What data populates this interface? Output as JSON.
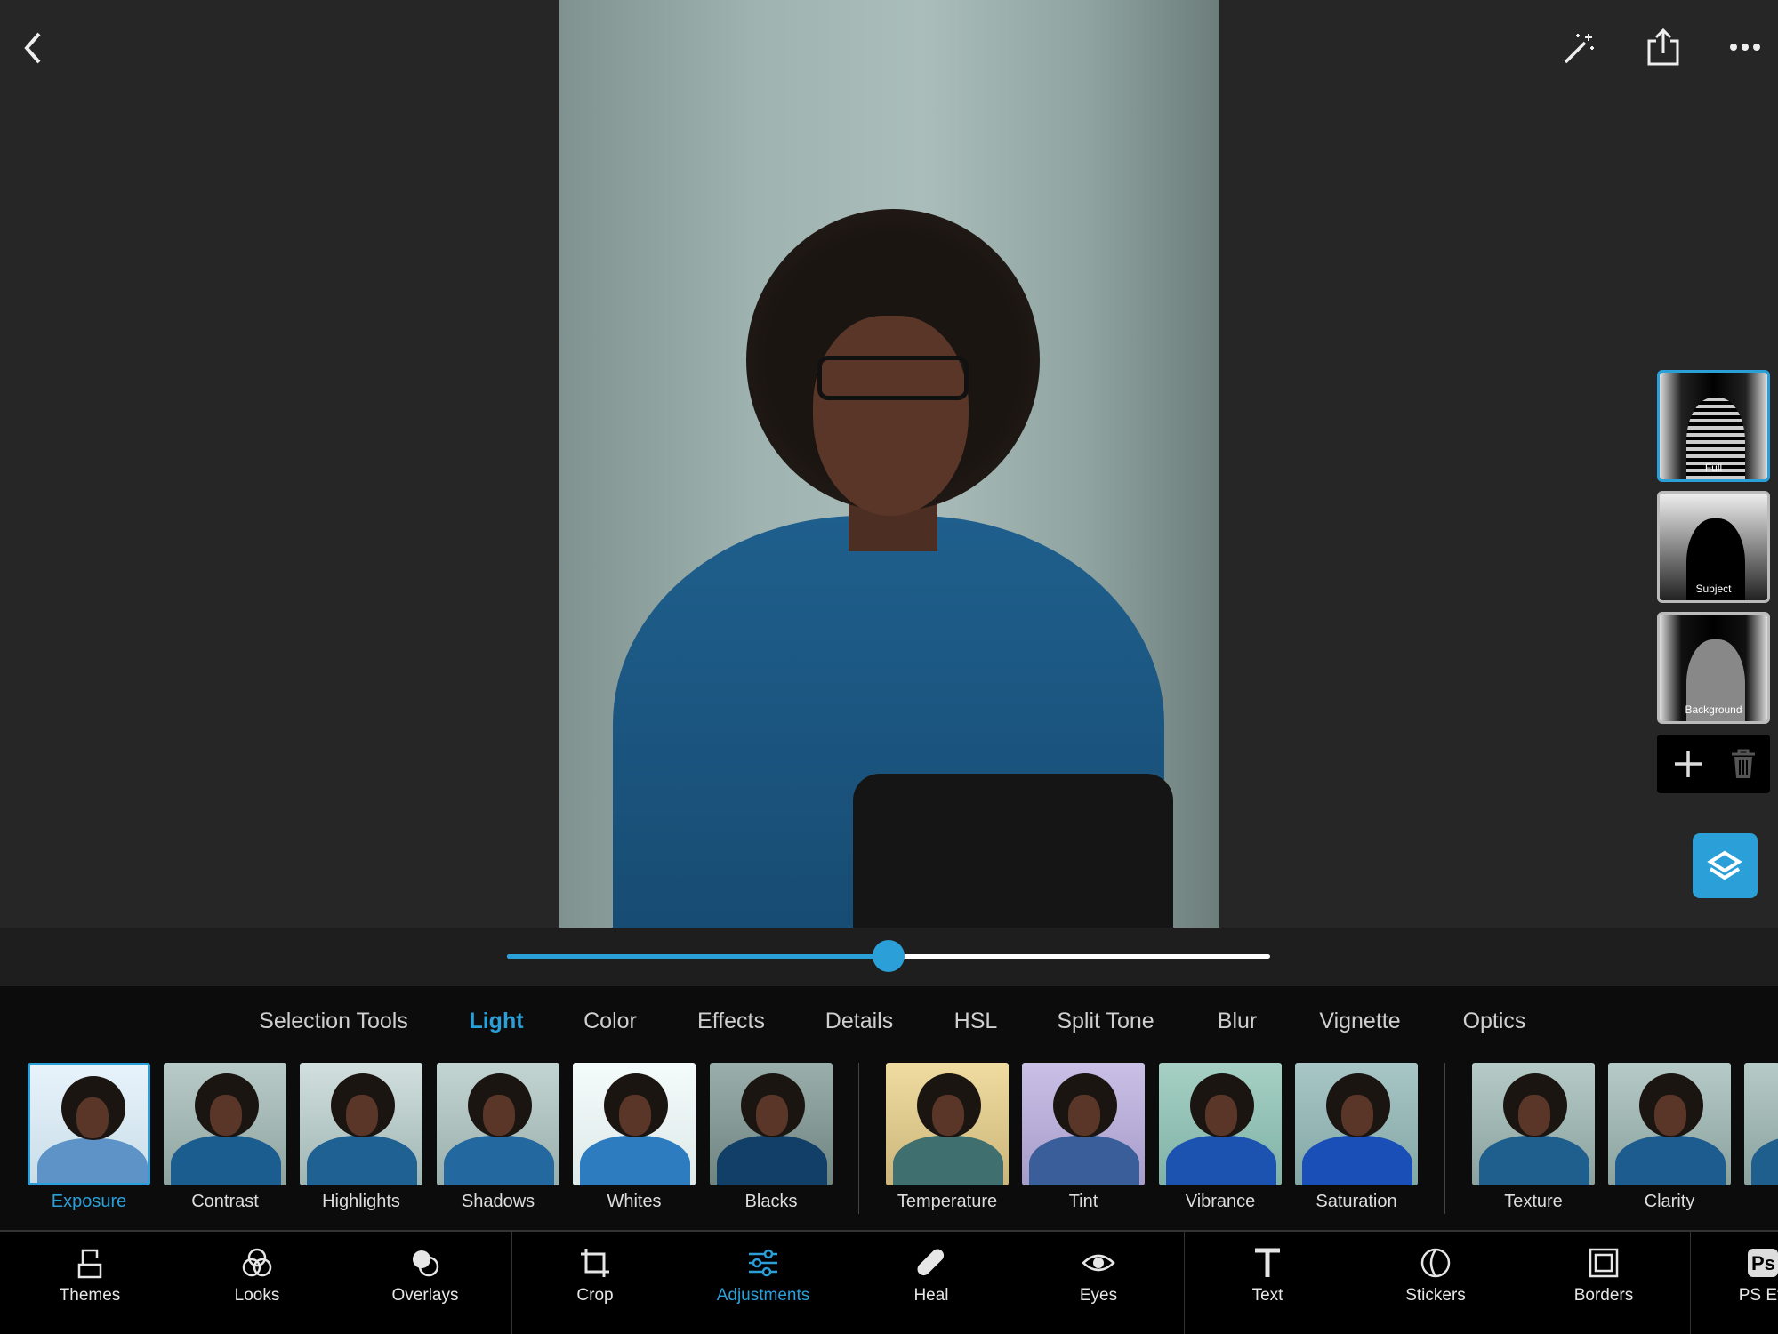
{
  "header": {
    "back_icon": "chevron-left-icon",
    "magic_icon": "magic-wand-icon",
    "share_icon": "share-icon",
    "more_icon": "more-horizontal-icon"
  },
  "slider": {
    "value": 0.5,
    "color": "#2a9fd8"
  },
  "tabs": [
    {
      "label": "Selection Tools"
    },
    {
      "label": "Light",
      "active": true
    },
    {
      "label": "Color"
    },
    {
      "label": "Effects"
    },
    {
      "label": "Details"
    },
    {
      "label": "HSL"
    },
    {
      "label": "Split Tone"
    },
    {
      "label": "Blur"
    },
    {
      "label": "Vignette"
    },
    {
      "label": "Optics"
    }
  ],
  "adjustments": [
    {
      "label": "Exposure",
      "selected": true
    },
    {
      "label": "Contrast"
    },
    {
      "label": "Highlights"
    },
    {
      "label": "Shadows"
    },
    {
      "label": "Whites"
    },
    {
      "label": "Blacks"
    },
    {
      "label": "Temperature"
    },
    {
      "label": "Tint"
    },
    {
      "label": "Vibrance"
    },
    {
      "label": "Saturation"
    },
    {
      "label": "Texture"
    },
    {
      "label": "Clarity"
    }
  ],
  "masks": [
    {
      "label": "Full",
      "selected": true
    },
    {
      "label": "Subject"
    },
    {
      "label": "Background"
    }
  ],
  "mask_actions": {
    "add_icon": "plus-icon",
    "delete_icon": "trash-icon",
    "layers_icon": "layers-icon"
  },
  "toolbar": [
    {
      "label": "Themes",
      "icon": "themes-icon"
    },
    {
      "label": "Looks",
      "icon": "looks-icon"
    },
    {
      "label": "Overlays",
      "icon": "overlays-icon"
    },
    {
      "label": "Crop",
      "icon": "crop-icon"
    },
    {
      "label": "Adjustments",
      "icon": "sliders-icon",
      "active": true
    },
    {
      "label": "Heal",
      "icon": "bandage-icon"
    },
    {
      "label": "Eyes",
      "icon": "eye-icon"
    },
    {
      "label": "Text",
      "icon": "text-icon"
    },
    {
      "label": "Stickers",
      "icon": "sticker-icon"
    },
    {
      "label": "Borders",
      "icon": "border-icon"
    },
    {
      "label": "PS Ef",
      "icon": "ps-icon",
      "badge": "Ps"
    }
  ],
  "accent": "#2a9fd8"
}
